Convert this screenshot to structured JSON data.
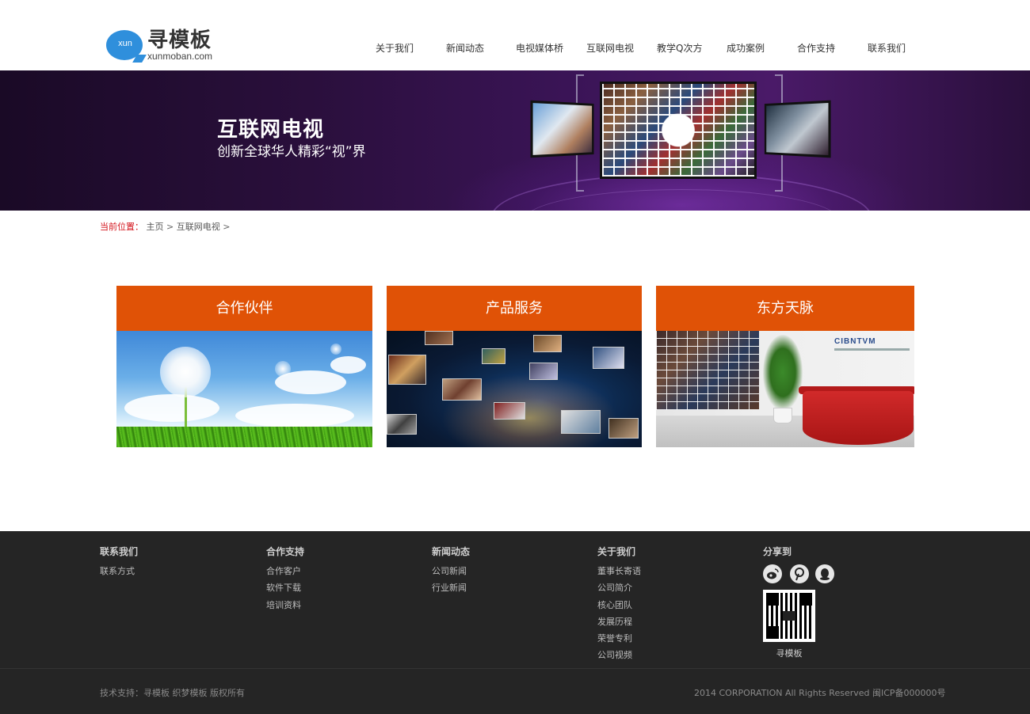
{
  "header": {
    "logo": {
      "badge": "xun",
      "name": "寻模板",
      "domain": "xunmoban.com"
    },
    "nav": [
      {
        "label": "关于我们"
      },
      {
        "label": "新闻动态"
      },
      {
        "label": "电视媒体桥"
      },
      {
        "label": "互联网电视"
      },
      {
        "label": "教学Q次方"
      },
      {
        "label": "成功案例"
      },
      {
        "label": "合作支持"
      },
      {
        "label": "联系我们"
      }
    ]
  },
  "banner": {
    "title": "互联网电视",
    "subtitle": "创新全球华人精彩“视”界"
  },
  "breadcrumb": {
    "label": "当前位置：",
    "home": "主页",
    "sep1": ">",
    "current": "互联网电视",
    "sep2": ">"
  },
  "cards": [
    {
      "title": "合作伙伴",
      "image": "dandelion-sky-photo"
    },
    {
      "title": "产品服务",
      "image": "world-media-photo"
    },
    {
      "title": "东方天脉",
      "image": "office-reception-photo",
      "brand": "CIBNTVM"
    }
  ],
  "footer": {
    "columns": [
      {
        "title": "联系我们",
        "links": [
          "联系方式"
        ]
      },
      {
        "title": "合作支持",
        "links": [
          "合作客户",
          "软件下载",
          "培训资料"
        ]
      },
      {
        "title": "新闻动态",
        "links": [
          "公司新闻",
          "行业新闻"
        ]
      },
      {
        "title": "关于我们",
        "links": [
          "董事长寄语",
          "公司简介",
          "核心团队",
          "发展历程",
          "荣誉专利",
          "公司视频"
        ]
      }
    ],
    "share": {
      "title": "分享到",
      "icons": [
        "weibo-icon",
        "pinterest-icon",
        "qq-icon"
      ],
      "qr_label": "寻模板"
    },
    "copyright_left": "技术支持：寻模板   织梦模板 版权所有",
    "copyright_right": "2014 CORPORATION All Rights Reserved 闽ICP备000000号"
  },
  "colors": {
    "accent": "#e05206",
    "breadcrumb_label": "#d4141c",
    "footer_bg": "#252525",
    "logo_blue": "#2f8fdc"
  }
}
